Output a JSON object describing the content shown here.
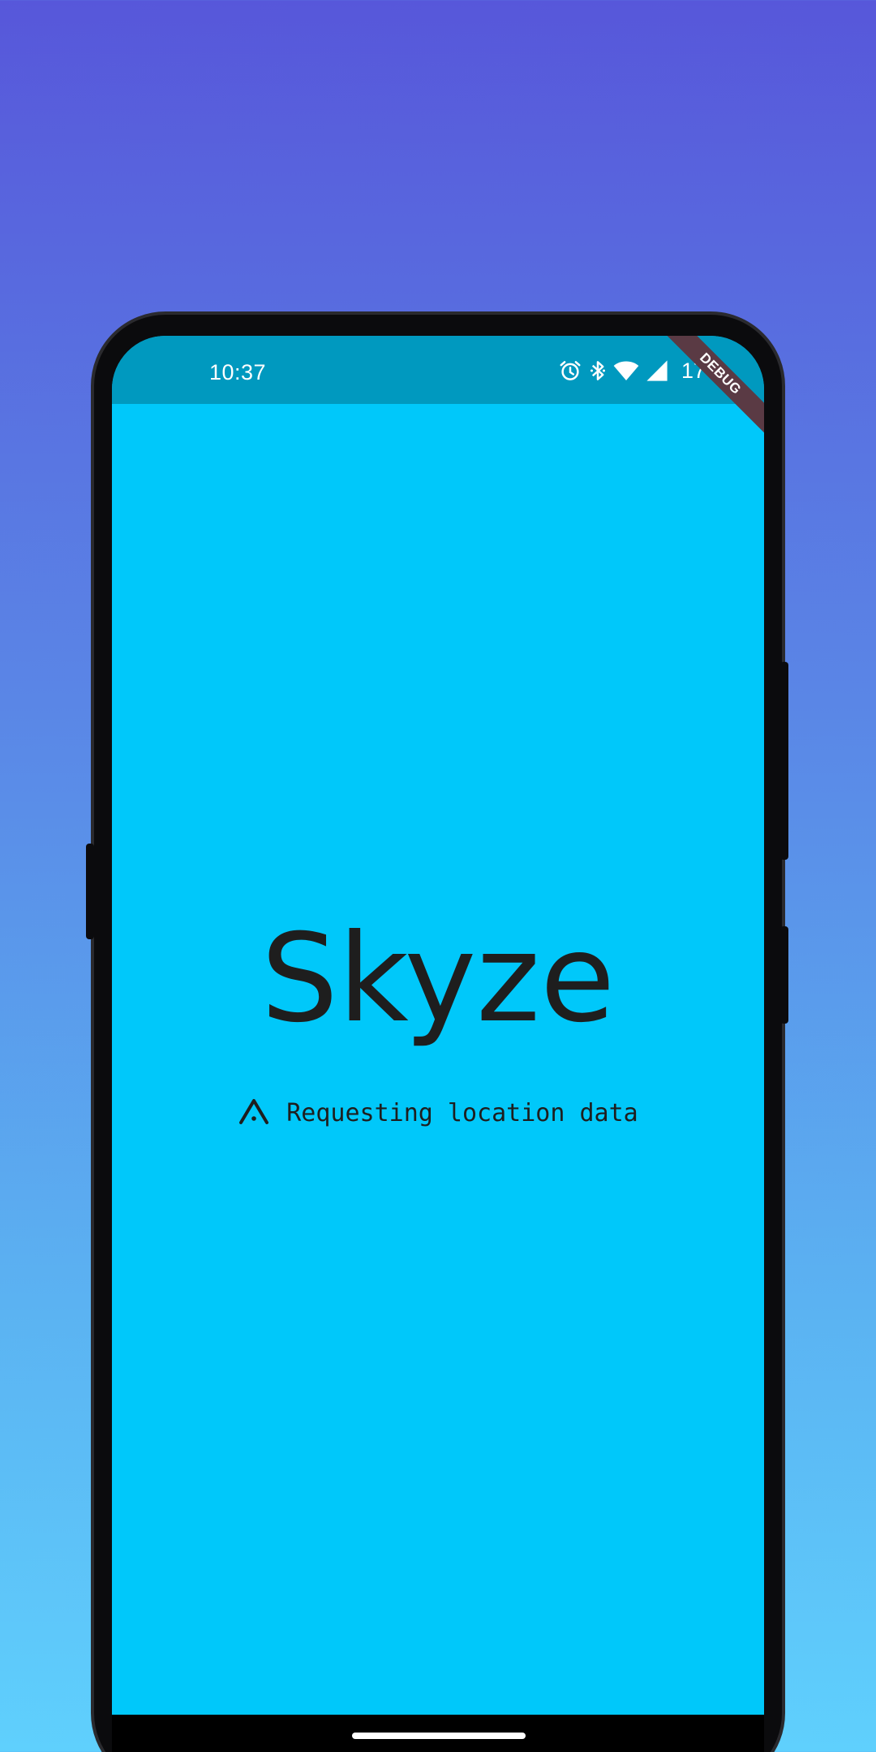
{
  "status_bar": {
    "time": "10:37",
    "battery_percent": "17%",
    "icons": [
      "alarm-icon",
      "bluetooth-icon",
      "wifi-icon",
      "cell-signal-icon"
    ]
  },
  "debug_banner": "DEBUG",
  "app": {
    "title": "Skyze",
    "status_message": "Requesting location data",
    "status_icon": "navigation-arrow-icon"
  },
  "colors": {
    "screen_background": "#00c8fa",
    "status_bar_background": "#0099bf",
    "text": "#1e1e1e",
    "debug_ribbon": "#5a3a44"
  }
}
